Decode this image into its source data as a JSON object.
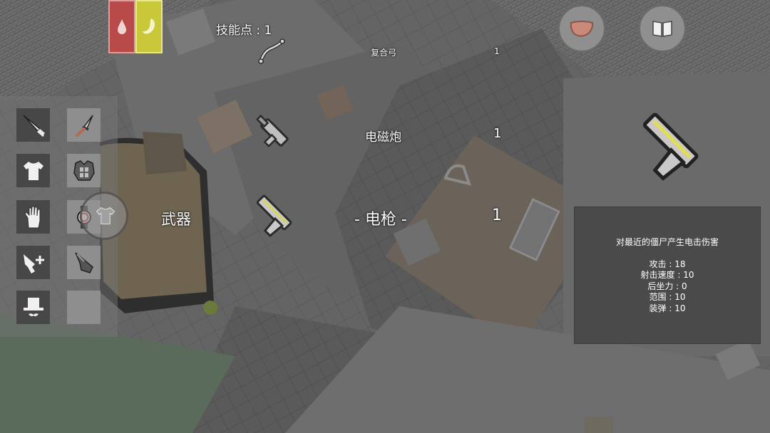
{
  "hud": {
    "skill_points_label": "技能点 : 1",
    "status_bars": [
      {
        "name": "blood",
        "icon": "blood-drop-icon",
        "bg": "#b84a4a",
        "border": "#d9a0a0"
      },
      {
        "name": "hunger",
        "icon": "stomach-icon",
        "bg": "#c8c83a",
        "border": "#e8e890"
      }
    ],
    "buttons": [
      {
        "name": "meat-button",
        "icon": "meat-icon"
      },
      {
        "name": "journal-button",
        "icon": "book-icon"
      }
    ]
  },
  "weapons": {
    "section_label": "武器",
    "list": [
      {
        "name": "复合弓",
        "count": "1",
        "icon": "bow-icon"
      },
      {
        "name": "电磁炮",
        "count": "1",
        "icon": "railgun-icon"
      },
      {
        "name": "- 电枪 -",
        "count": "1",
        "icon": "electric-pistol-icon"
      }
    ]
  },
  "equipment_slots": [
    {
      "icon": "knife-icon",
      "style": "dark"
    },
    {
      "icon": "dagger-icon",
      "style": "light"
    },
    {
      "icon": "shirt-icon",
      "style": "dark"
    },
    {
      "icon": "armor-icon",
      "style": "light"
    },
    {
      "icon": "glove-icon",
      "style": "dark"
    },
    {
      "icon": "watch-icon",
      "style": "light"
    },
    {
      "icon": "pistol-plus-icon",
      "style": "dark"
    },
    {
      "icon": "boomerang-icon",
      "style": "light"
    },
    {
      "icon": "hat-icon",
      "style": "dark"
    },
    {
      "icon": "empty-slot",
      "style": "light"
    }
  ],
  "selected_weapon": {
    "description": "对最近的僵尸产生电击伤害",
    "stats": [
      "攻击 : 18",
      "射击速度 : 10",
      "后坐力 : 0",
      "范围 : 10",
      "装弹 : 10"
    ],
    "icon": "electric-pistol-icon"
  }
}
